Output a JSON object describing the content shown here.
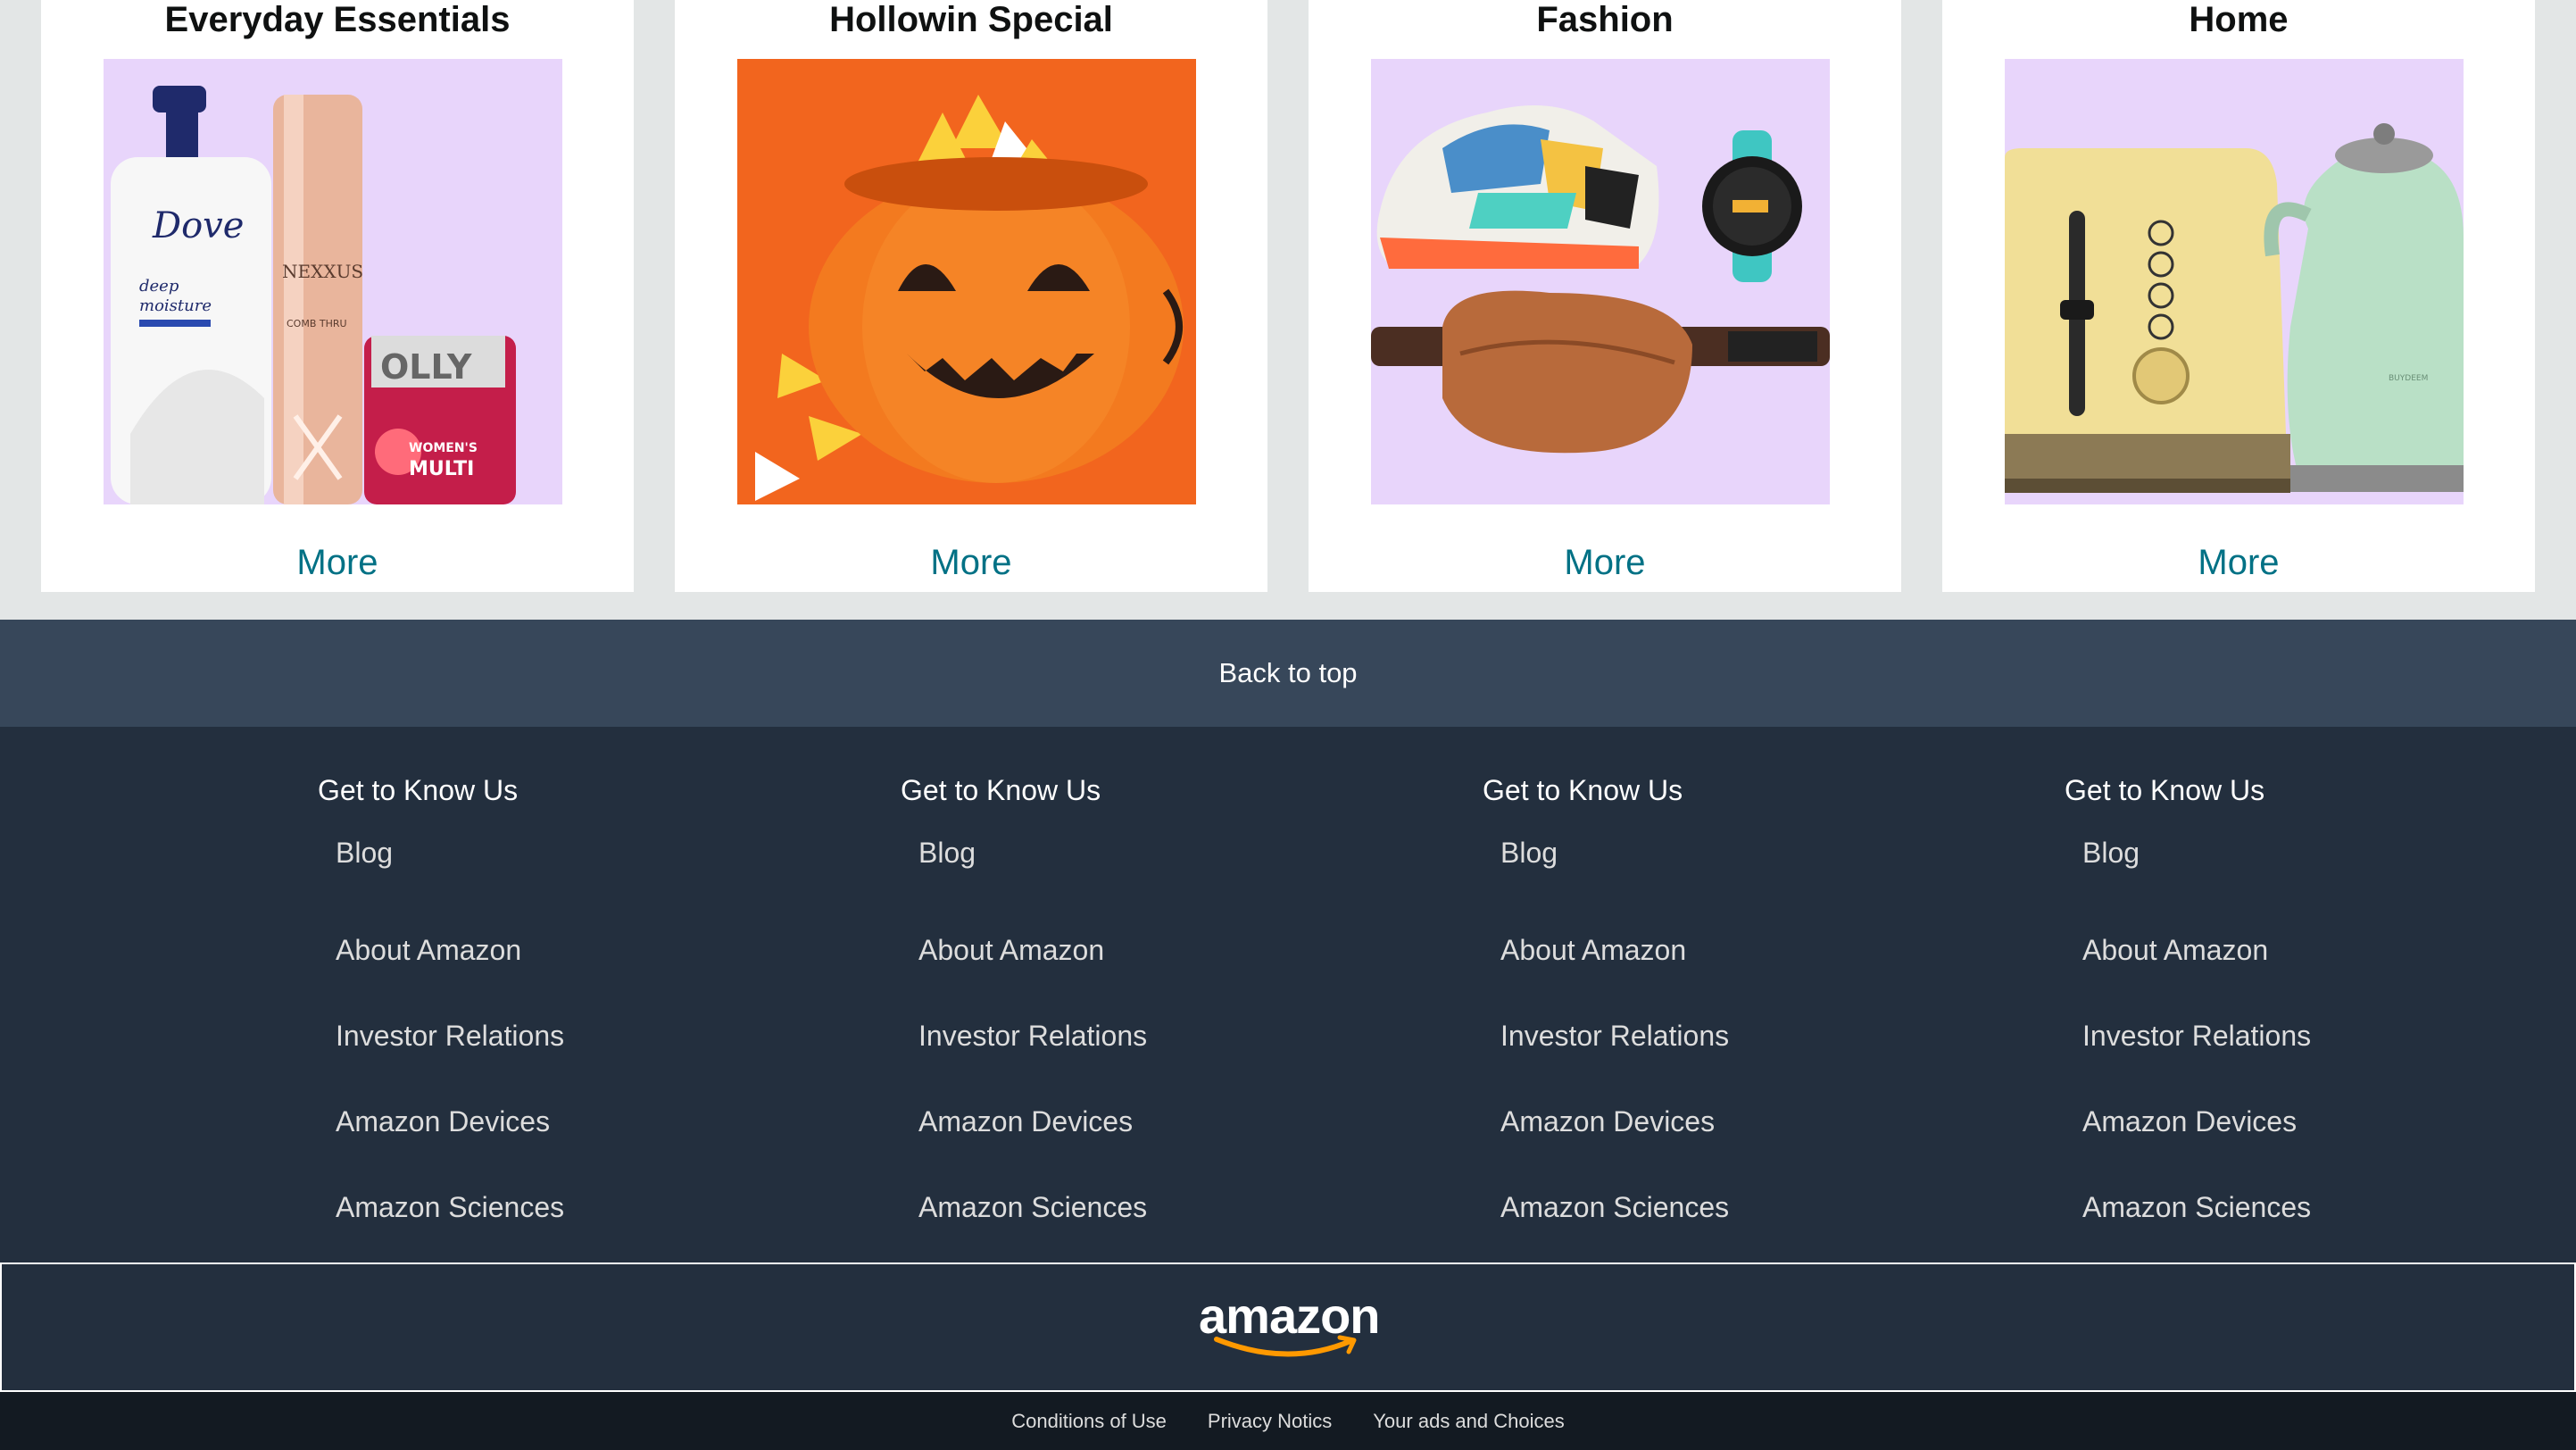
{
  "cards": [
    {
      "title": "Everyday Essentials",
      "more_label": "More",
      "image_name": "everyday-essentials-image",
      "product_labels": [
        "Dove",
        "deep moisture",
        "NEXXUS",
        "OLLY",
        "WOMEN'S MULTI"
      ]
    },
    {
      "title": "Hollowin Special",
      "more_label": "More",
      "image_name": "pumpkin-candy-image"
    },
    {
      "title": "Fashion",
      "more_label": "More",
      "image_name": "fashion-image"
    },
    {
      "title": "Home",
      "more_label": "More",
      "image_name": "home-appliances-image",
      "product_labels": [
        "BUYDEEM"
      ]
    }
  ],
  "back_to_top": "Back to top",
  "footer_columns": [
    {
      "heading": "Get to Know Us",
      "links": [
        "Blog",
        "About Amazon",
        "Investor Relations",
        "Amazon Devices",
        "Amazon Sciences"
      ]
    },
    {
      "heading": "Get to Know Us",
      "links": [
        "Blog",
        "About Amazon",
        "Investor Relations",
        "Amazon Devices",
        "Amazon Sciences"
      ]
    },
    {
      "heading": "Get to Know Us",
      "links": [
        "Blog",
        "About Amazon",
        "Investor Relations",
        "Amazon Devices",
        "Amazon Sciences"
      ]
    },
    {
      "heading": "Get to Know Us",
      "links": [
        "Blog",
        "About Amazon",
        "Investor Relations",
        "Amazon Devices",
        "Amazon Sciences"
      ]
    }
  ],
  "logo_text": "amazon",
  "legal_links": [
    "Conditions of Use",
    "Privacy Notics",
    "Your ads and Choices"
  ],
  "colors": {
    "page_bg": "#e3e6e6",
    "link_teal": "#007185",
    "back_to_top_bg": "#37475a",
    "footer_bg": "#232f3e",
    "legal_bg": "#131a22",
    "logo_smile": "#ff9900",
    "card_image_bg": "#e8d5fb"
  }
}
